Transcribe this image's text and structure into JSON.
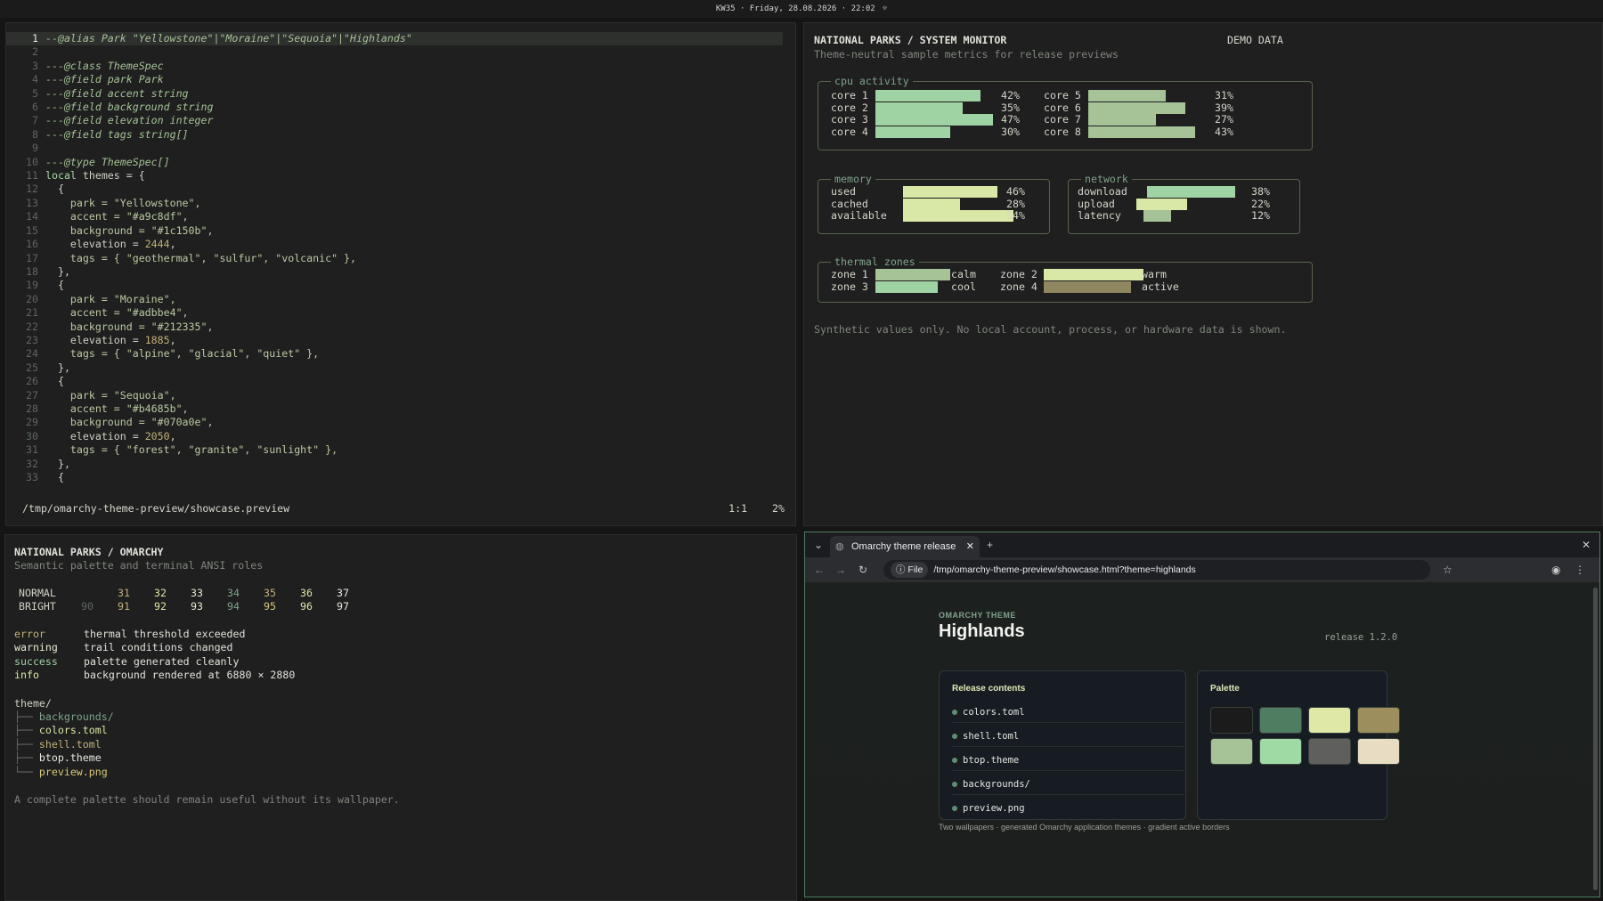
{
  "topbar": {
    "text": "KW35 · Friday, 28.08.2026 · 22:02",
    "icon": "sun-icon"
  },
  "editor": {
    "lines": [
      {
        "n": "1",
        "t": "--@alias Park \"Yellowstone\"|\"Moraine\"|\"Sequoia\"|\"Highlands\"",
        "k": "cmt"
      },
      {
        "n": "2",
        "t": "",
        "k": "pl"
      },
      {
        "n": "3",
        "t": "---@class ThemeSpec",
        "k": "cmt"
      },
      {
        "n": "4",
        "t": "---@field park Park",
        "k": "cmt"
      },
      {
        "n": "5",
        "t": "---@field accent string",
        "k": "cmt"
      },
      {
        "n": "6",
        "t": "---@field background string",
        "k": "cmt"
      },
      {
        "n": "7",
        "t": "---@field elevation integer",
        "k": "cmt"
      },
      {
        "n": "8",
        "t": "---@field tags string[]",
        "k": "cmt"
      },
      {
        "n": "9",
        "t": "",
        "k": "pl"
      },
      {
        "n": "10",
        "t": "---@type ThemeSpec[]",
        "k": "cmt"
      },
      {
        "n": "11",
        "t": "local themes = {",
        "k": "local"
      },
      {
        "n": "12",
        "t": "  {",
        "k": "pl"
      },
      {
        "n": "13",
        "t": "    park = \"Yellowstone\",",
        "k": "str"
      },
      {
        "n": "14",
        "t": "    accent = \"#a9c8df\",",
        "k": "str"
      },
      {
        "n": "15",
        "t": "    background = \"#1c150b\",",
        "k": "str"
      },
      {
        "n": "16",
        "t": "    elevation = 2444,",
        "k": "num"
      },
      {
        "n": "17",
        "t": "    tags = { \"geothermal\", \"sulfur\", \"volcanic\" },",
        "k": "str"
      },
      {
        "n": "18",
        "t": "  },",
        "k": "pl"
      },
      {
        "n": "19",
        "t": "  {",
        "k": "pl"
      },
      {
        "n": "20",
        "t": "    park = \"Moraine\",",
        "k": "str"
      },
      {
        "n": "21",
        "t": "    accent = \"#adbbe4\",",
        "k": "str"
      },
      {
        "n": "22",
        "t": "    background = \"#212335\",",
        "k": "str"
      },
      {
        "n": "23",
        "t": "    elevation = 1885,",
        "k": "num"
      },
      {
        "n": "24",
        "t": "    tags = { \"alpine\", \"glacial\", \"quiet\" },",
        "k": "str"
      },
      {
        "n": "25",
        "t": "  },",
        "k": "pl"
      },
      {
        "n": "26",
        "t": "  {",
        "k": "pl"
      },
      {
        "n": "27",
        "t": "    park = \"Sequoia\",",
        "k": "str"
      },
      {
        "n": "28",
        "t": "    accent = \"#b4685b\",",
        "k": "str"
      },
      {
        "n": "29",
        "t": "    background = \"#070a0e\",",
        "k": "str"
      },
      {
        "n": "30",
        "t": "    elevation = 2050,",
        "k": "num"
      },
      {
        "n": "31",
        "t": "    tags = { \"forest\", \"granite\", \"sunlight\" },",
        "k": "str"
      },
      {
        "n": "32",
        "t": "  },",
        "k": "pl"
      },
      {
        "n": "33",
        "t": "  {",
        "k": "pl"
      }
    ],
    "status": {
      "path": "/tmp/omarchy-theme-preview/showcase.preview",
      "pos": "1:1",
      "pct": "2%"
    }
  },
  "monitor": {
    "title": "NATIONAL PARKS / SYSTEM MONITOR",
    "subtitle": "Theme-neutral sample metrics for release previews",
    "badge": "DEMO DATA",
    "cpu": {
      "label": "cpu activity",
      "cores": [
        {
          "name": "core 1",
          "pct": "42%",
          "v": 42
        },
        {
          "name": "core 2",
          "pct": "35%",
          "v": 35
        },
        {
          "name": "core 3",
          "pct": "47%",
          "v": 47
        },
        {
          "name": "core 4",
          "pct": "30%",
          "v": 30
        },
        {
          "name": "core 5",
          "pct": "31%",
          "v": 31
        },
        {
          "name": "core 6",
          "pct": "39%",
          "v": 39
        },
        {
          "name": "core 7",
          "pct": "27%",
          "v": 27
        },
        {
          "name": "core 8",
          "pct": "43%",
          "v": 43
        }
      ]
    },
    "memory": {
      "label": "memory",
      "rows": [
        {
          "name": "used",
          "pct": "46%",
          "v": 46
        },
        {
          "name": "cached",
          "pct": "28%",
          "v": 28
        },
        {
          "name": "available",
          "pct": "54%",
          "v": 54
        }
      ]
    },
    "network": {
      "label": "network",
      "rows": [
        {
          "name": "download",
          "pct": "38%",
          "v": 38
        },
        {
          "name": "upload",
          "pct": "22%",
          "v": 22
        },
        {
          "name": "latency",
          "pct": "12%",
          "v": 12
        }
      ]
    },
    "thermal": {
      "label": "thermal zones",
      "zones": [
        {
          "name": "zone 1",
          "state": "calm",
          "color": "#a6c397"
        },
        {
          "name": "zone 2",
          "state": "warm",
          "color": "#d9e8a6"
        },
        {
          "name": "zone 3",
          "state": "cool",
          "color": "#9fd3a3"
        },
        {
          "name": "zone 4",
          "state": "active",
          "color": "#8f8760"
        }
      ]
    },
    "footer": "Synthetic values only. No local account, process, or hardware data is shown."
  },
  "palette": {
    "title": "NATIONAL PARKS / OMARCHY",
    "subtitle": "Semantic palette and terminal ANSI roles",
    "normal_label": "NORMAL",
    "bright_label": "BRIGHT",
    "normal": [
      {
        "code": "",
        "color": "#cfd2c6"
      },
      {
        "code": "31",
        "color": "#c2b07a"
      },
      {
        "code": "32",
        "color": "#d9e8a6"
      },
      {
        "code": "33",
        "color": "#e8e8d0"
      },
      {
        "code": "34",
        "color": "#7fa38c"
      },
      {
        "code": "35",
        "color": "#c2b07a"
      },
      {
        "code": "36",
        "color": "#d9e8a6"
      },
      {
        "code": "37",
        "color": "#e8e8e0"
      }
    ],
    "bright": [
      {
        "code": "90",
        "color": "#5f6660"
      },
      {
        "code": "91",
        "color": "#c2b07a"
      },
      {
        "code": "92",
        "color": "#d9e8a6"
      },
      {
        "code": "93",
        "color": "#e8e8d0"
      },
      {
        "code": "94",
        "color": "#7fa38c"
      },
      {
        "code": "95",
        "color": "#d9c77a"
      },
      {
        "code": "96",
        "color": "#d9e8a6"
      },
      {
        "code": "97",
        "color": "#e8e8e0"
      }
    ],
    "statuses": [
      {
        "role": "error",
        "text": "thermal threshold exceeded",
        "color": "#c2b07a"
      },
      {
        "role": "warning",
        "text": "trail conditions changed",
        "color": "#e8e8d0"
      },
      {
        "role": "success",
        "text": "palette generated cleanly",
        "color": "#9fd3a3"
      },
      {
        "role": "info",
        "text": "background rendered at 6880 × 2880",
        "color": "#d9e8a6"
      }
    ],
    "tree_root": "theme/",
    "tree": [
      {
        "branch": "├── ",
        "name": "backgrounds/",
        "color": "#7fa38c"
      },
      {
        "branch": "├── ",
        "name": "colors.toml",
        "color": "#d9e8a6"
      },
      {
        "branch": "├── ",
        "name": "shell.toml",
        "color": "#c2b07a"
      },
      {
        "branch": "├── ",
        "name": "btop.theme",
        "color": "#e8e8e0"
      },
      {
        "branch": "└── ",
        "name": "preview.png",
        "color": "#d9c77a"
      }
    ],
    "footer": "A complete palette should remain useful without its wallpaper."
  },
  "browser": {
    "tab_title": "Omarchy theme release",
    "url_chip": "File",
    "url": "/tmp/omarchy-theme-preview/showcase.html?theme=highlands",
    "eyebrow": "OMARCHY THEME",
    "title": "Highlands",
    "release": "release 1.2.0",
    "contents_title": "Release contents",
    "files": [
      "colors.toml",
      "shell.toml",
      "btop.theme",
      "backgrounds/",
      "preview.png"
    ],
    "palette_title": "Palette",
    "swatches": [
      "#1a1b1a",
      "#4f7d62",
      "#dfe8a6",
      "#9c8f5d",
      "#a6c397",
      "#9fd9a3",
      "#5f605e",
      "#e8dcc3"
    ],
    "footer": "Two wallpapers · generated Omarchy application themes · gradient active borders"
  }
}
